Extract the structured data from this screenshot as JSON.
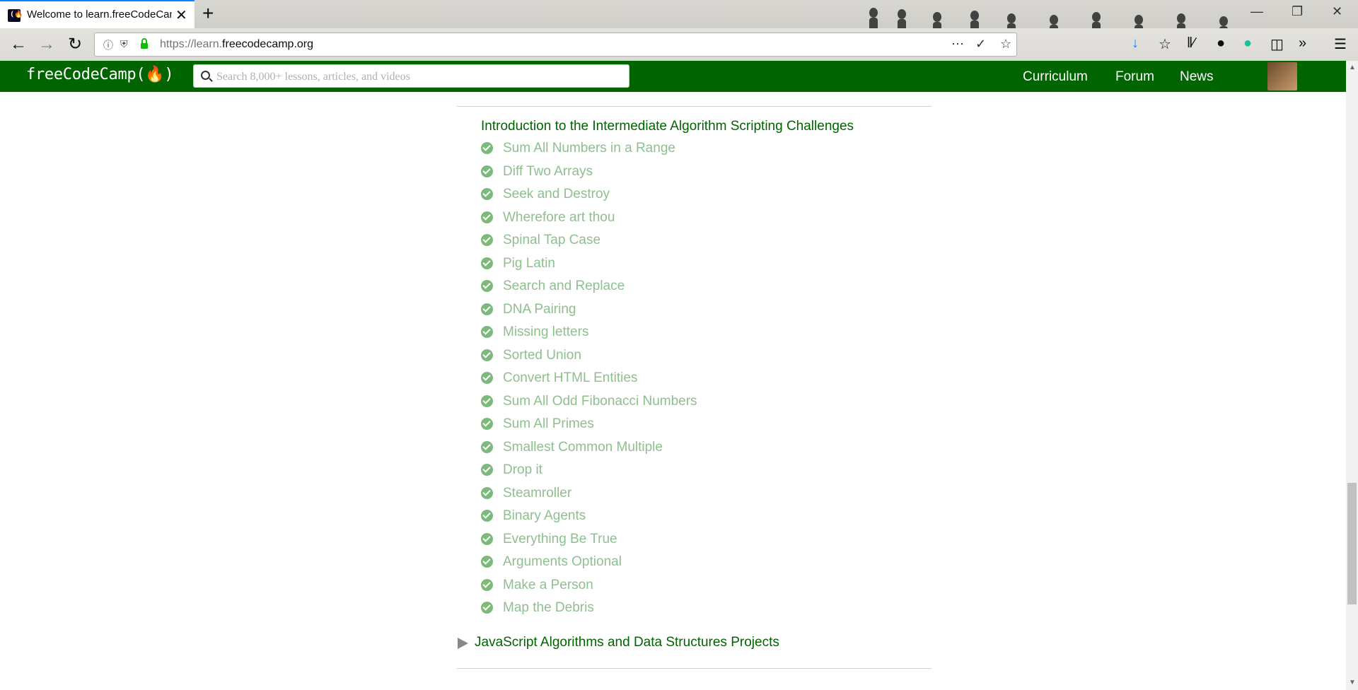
{
  "browser": {
    "tab_title": "Welcome to learn.freeCodeCamp",
    "tab_close": "✕",
    "new_tab": "+",
    "url_prefix": "https://learn.",
    "url_domain": "freecodecamp.org",
    "accent": "#0a84ff"
  },
  "site": {
    "logo": "freeCodeCamp(🔥)",
    "search_placeholder": "Search 8,000+ lessons, articles, and videos",
    "nav": [
      "Curriculum",
      "Forum",
      "News"
    ],
    "brand_color": "#006400"
  },
  "content": {
    "section_title": "Introduction to the Intermediate Algorithm Scripting Challenges",
    "challenges": [
      "Sum All Numbers in a Range",
      "Diff Two Arrays",
      "Seek and Destroy",
      "Wherefore art thou",
      "Spinal Tap Case",
      "Pig Latin",
      "Search and Replace",
      "DNA Pairing",
      "Missing letters",
      "Sorted Union",
      "Convert HTML Entities",
      "Sum All Odd Fibonacci Numbers",
      "Sum All Primes",
      "Smallest Common Multiple",
      "Drop it",
      "Steamroller",
      "Binary Agents",
      "Everything Be True",
      "Arguments Optional",
      "Make a Person",
      "Map the Debris"
    ],
    "next_superblock": "JavaScript Algorithms and Data Structures Projects",
    "completed_color": "#7cba7c"
  }
}
